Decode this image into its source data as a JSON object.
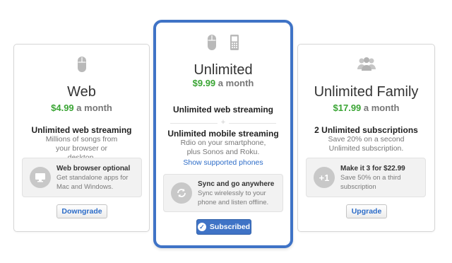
{
  "colors": {
    "accent": "#3f73c6",
    "price_green": "#3aa534",
    "link_blue": "#2c6cc8"
  },
  "plans": {
    "web": {
      "icons": [
        "mouse-icon"
      ],
      "title": "Web",
      "price": "$4.99",
      "period": "a month",
      "feature_title": "Unlimited web streaming",
      "feature_desc": "Millions of songs from your browser or desktop.",
      "info_icon": "monitor-icon",
      "info_title": "Web browser optional",
      "info_desc": "Get standalone apps for Mac and Windows.",
      "button": "Downgrade"
    },
    "unlimited": {
      "icons": [
        "mouse-icon",
        "phone-icon"
      ],
      "title": "Unlimited",
      "price": "$9.99",
      "period": "a month",
      "feature_title": "Unlimited web streaming",
      "plus": "+",
      "feature2_title": "Unlimited mobile streaming",
      "feature2_desc": "Rdio on your smartphone, plus Sonos and Roku.",
      "link": "Show supported phones",
      "info_icon": "sync-icon",
      "info_title": "Sync and go anywhere",
      "info_desc": "Sync wirelessly to your phone and listen offline.",
      "button": "Subscribed"
    },
    "family": {
      "icons": [
        "people-icon"
      ],
      "title": "Unlimited Family",
      "price": "$17.99",
      "period": "a month",
      "feature_title": "2 Unlimited subscriptions",
      "feature_desc": "Save 20% on a second Unlimited subscription.",
      "info_icon": "plus-one-icon",
      "info_badge": "+1",
      "info_title": "Make it 3 for $22.99",
      "info_desc": "Save 50% on a third subscription",
      "button": "Upgrade"
    }
  }
}
